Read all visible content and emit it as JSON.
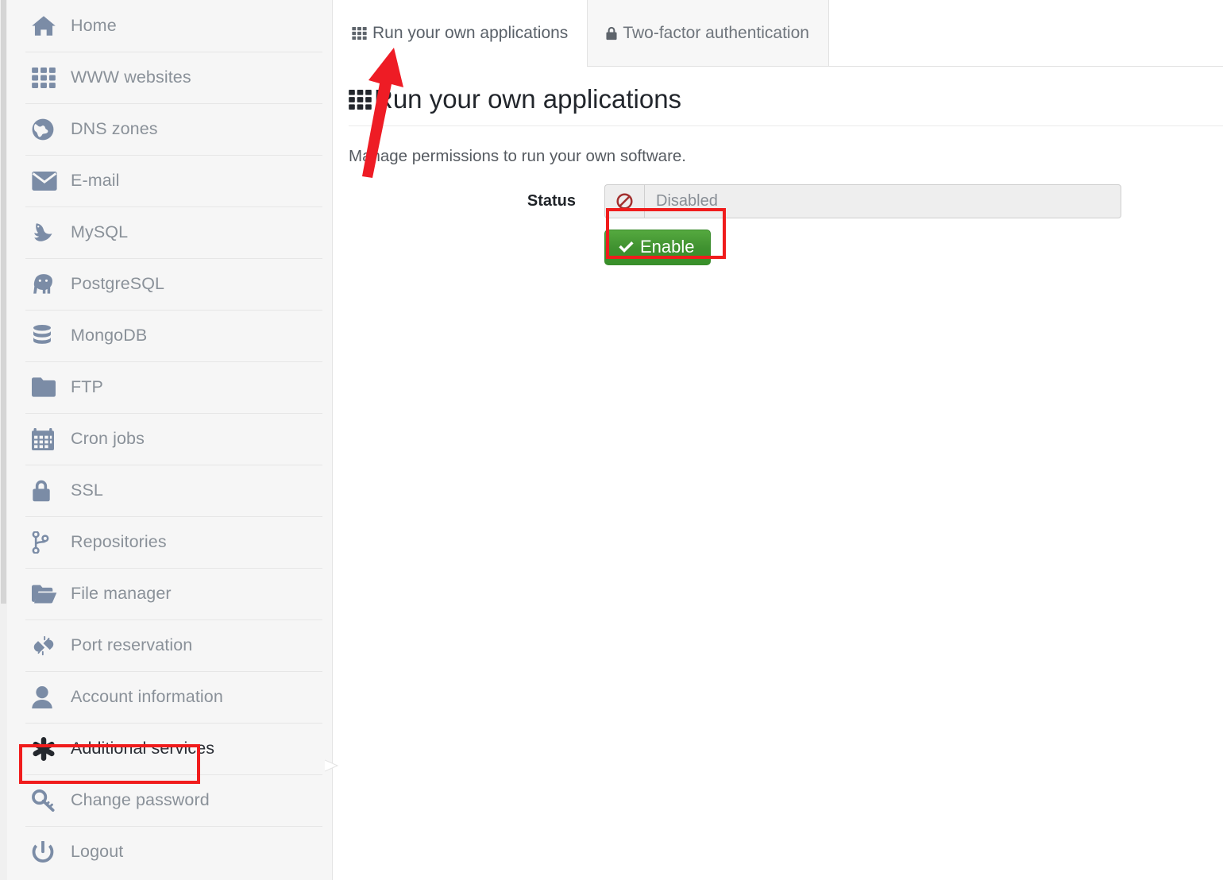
{
  "sidebar": {
    "items": [
      {
        "label": "Home",
        "icon": "home-icon",
        "active": false
      },
      {
        "label": "WWW websites",
        "icon": "grid-icon",
        "active": false
      },
      {
        "label": "DNS zones",
        "icon": "globe-icon",
        "active": false
      },
      {
        "label": "E-mail",
        "icon": "envelope-icon",
        "active": false
      },
      {
        "label": "MySQL",
        "icon": "dolphin-icon",
        "active": false
      },
      {
        "label": "PostgreSQL",
        "icon": "elephant-icon",
        "active": false
      },
      {
        "label": "MongoDB",
        "icon": "database-icon",
        "active": false
      },
      {
        "label": "FTP",
        "icon": "folder-icon",
        "active": false
      },
      {
        "label": "Cron jobs",
        "icon": "calendar-icon",
        "active": false
      },
      {
        "label": "SSL",
        "icon": "lock-icon",
        "active": false
      },
      {
        "label": "Repositories",
        "icon": "code-branch-icon",
        "active": false
      },
      {
        "label": "File manager",
        "icon": "folder-open-icon",
        "active": false
      },
      {
        "label": "Port reservation",
        "icon": "plug-icon",
        "active": false
      },
      {
        "label": "Account information",
        "icon": "user-icon",
        "active": false
      },
      {
        "label": "Additional services",
        "icon": "asterisk-icon",
        "active": true
      },
      {
        "label": "Change password",
        "icon": "key-icon",
        "active": false
      },
      {
        "label": "Logout",
        "icon": "power-icon",
        "active": false
      }
    ]
  },
  "tabs": [
    {
      "label": "Run your own applications",
      "icon": "grid-icon",
      "active": true
    },
    {
      "label": "Two-factor authentication",
      "icon": "lock-icon",
      "active": false
    }
  ],
  "main": {
    "title": "Run your own applications",
    "title_icon": "grid-icon",
    "description": "Manage permissions to run your own software.",
    "status": {
      "label": "Status",
      "icon": "ban-icon",
      "value": "Disabled"
    },
    "enable_button": {
      "label": "Enable",
      "icon": "check-icon"
    }
  },
  "annotations": {
    "highlight_color": "#f01c1c",
    "arrow_color": "#ee1c25",
    "highlight_targets": [
      "sidebar-item-additional-services",
      "enable-button"
    ],
    "arrow_target": "tab-run-your-own-applications"
  },
  "colors": {
    "sidebar_bg": "#f6f6f6",
    "sidebar_text": "#8a9199",
    "sidebar_icon": "#7b8ca6",
    "active_text": "#2b2f36",
    "button_green": "#48a13a",
    "status_icon_red": "#a02a2a",
    "page_bg": "#ffffff"
  }
}
